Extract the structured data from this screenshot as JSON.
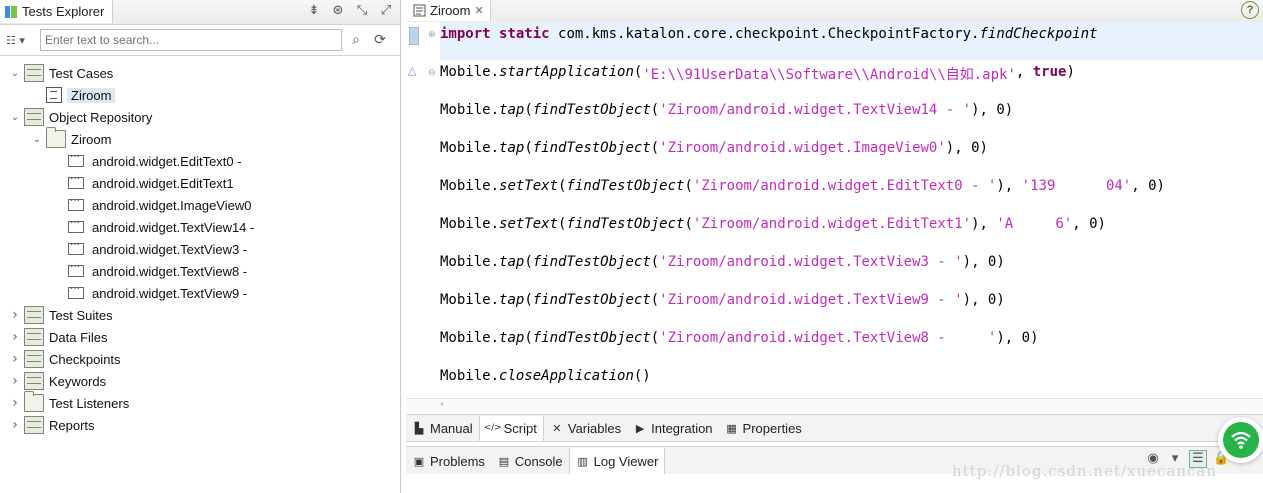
{
  "explorer": {
    "title": "Tests Explorer",
    "search_placeholder": "Enter text to search...",
    "tree": [
      {
        "label": "Test Cases",
        "level": 0,
        "state": "expanded",
        "icon": "test-cases-icon"
      },
      {
        "label": "Ziroom",
        "level": 1,
        "state": "leaf",
        "icon": "test-case-icon",
        "selected": true
      },
      {
        "label": "Object Repository",
        "level": 0,
        "state": "expanded",
        "icon": "object-repository-icon"
      },
      {
        "label": "Ziroom",
        "level": 1,
        "state": "expanded",
        "icon": "folder-icon"
      },
      {
        "label": "android.widget.EditText0 -",
        "level": 2,
        "state": "leaf",
        "icon": "test-object-icon"
      },
      {
        "label": "android.widget.EditText1",
        "level": 2,
        "state": "leaf",
        "icon": "test-object-icon"
      },
      {
        "label": "android.widget.ImageView0",
        "level": 2,
        "state": "leaf",
        "icon": "test-object-icon"
      },
      {
        "label": "android.widget.TextView14 -",
        "level": 2,
        "state": "leaf",
        "icon": "test-object-icon"
      },
      {
        "label": "android.widget.TextView3 -",
        "level": 2,
        "state": "leaf",
        "icon": "test-object-icon"
      },
      {
        "label": "android.widget.TextView8 -",
        "level": 2,
        "state": "leaf",
        "icon": "test-object-icon"
      },
      {
        "label": "android.widget.TextView9 -",
        "level": 2,
        "state": "leaf",
        "icon": "test-object-icon"
      },
      {
        "label": "Test Suites",
        "level": 0,
        "state": "collapsed",
        "icon": "test-suites-icon"
      },
      {
        "label": "Data Files",
        "level": 0,
        "state": "collapsed",
        "icon": "data-files-icon"
      },
      {
        "label": "Checkpoints",
        "level": 0,
        "state": "collapsed",
        "icon": "checkpoints-icon"
      },
      {
        "label": "Keywords",
        "level": 0,
        "state": "collapsed",
        "icon": "keywords-icon"
      },
      {
        "label": "Test Listeners",
        "level": 0,
        "state": "collapsed",
        "icon": "test-listeners-icon"
      },
      {
        "label": "Reports",
        "level": 0,
        "state": "collapsed",
        "icon": "reports-icon"
      }
    ]
  },
  "editor": {
    "tab_title": "Ziroom",
    "help_label": "?",
    "lines": [
      {
        "tokens": [
          [
            "kw",
            "import"
          ],
          [
            "p",
            " "
          ],
          [
            "kw",
            "static"
          ],
          [
            "p",
            " com.kms.katalon.core.checkpoint.CheckpointFactory."
          ],
          [
            "it",
            "findCheckpoint"
          ]
        ]
      },
      {
        "tokens": [
          [
            "p",
            "Mobile."
          ],
          [
            "it",
            "startApplication"
          ],
          [
            "p",
            "("
          ],
          [
            "str",
            "'E:\\\\91UserData\\\\Software\\\\Android\\\\自如.apk'"
          ],
          [
            "p",
            ", "
          ],
          [
            "kw",
            "true"
          ],
          [
            "p",
            ")"
          ]
        ]
      },
      {
        "tokens": [
          [
            "p",
            "Mobile."
          ],
          [
            "it",
            "tap"
          ],
          [
            "p",
            "("
          ],
          [
            "it",
            "findTestObject"
          ],
          [
            "p",
            "("
          ],
          [
            "str",
            "'Ziroom/android.widget.TextView14 - '"
          ],
          [
            "p",
            "), 0)"
          ]
        ]
      },
      {
        "tokens": [
          [
            "p",
            "Mobile."
          ],
          [
            "it",
            "tap"
          ],
          [
            "p",
            "("
          ],
          [
            "it",
            "findTestObject"
          ],
          [
            "p",
            "("
          ],
          [
            "str",
            "'Ziroom/android.widget.ImageView0'"
          ],
          [
            "p",
            "), 0)"
          ]
        ]
      },
      {
        "tokens": [
          [
            "p",
            "Mobile."
          ],
          [
            "it",
            "setText"
          ],
          [
            "p",
            "("
          ],
          [
            "it",
            "findTestObject"
          ],
          [
            "p",
            "("
          ],
          [
            "str",
            "'Ziroom/android.widget.EditText0 - '"
          ],
          [
            "p",
            "), "
          ],
          [
            "str",
            "'139      04'"
          ],
          [
            "p",
            ", 0)"
          ]
        ]
      },
      {
        "tokens": [
          [
            "p",
            "Mobile."
          ],
          [
            "it",
            "setText"
          ],
          [
            "p",
            "("
          ],
          [
            "it",
            "findTestObject"
          ],
          [
            "p",
            "("
          ],
          [
            "str",
            "'Ziroom/android.widget.EditText1'"
          ],
          [
            "p",
            "), "
          ],
          [
            "str",
            "'A     6'"
          ],
          [
            "p",
            ", 0)"
          ]
        ]
      },
      {
        "tokens": [
          [
            "p",
            "Mobile."
          ],
          [
            "it",
            "tap"
          ],
          [
            "p",
            "("
          ],
          [
            "it",
            "findTestObject"
          ],
          [
            "p",
            "("
          ],
          [
            "str",
            "'Ziroom/android.widget.TextView3 - '"
          ],
          [
            "p",
            "), 0)"
          ]
        ]
      },
      {
        "tokens": [
          [
            "p",
            "Mobile."
          ],
          [
            "it",
            "tap"
          ],
          [
            "p",
            "("
          ],
          [
            "it",
            "findTestObject"
          ],
          [
            "p",
            "("
          ],
          [
            "str",
            "'Ziroom/android.widget.TextView9 - '"
          ],
          [
            "p",
            "), 0)"
          ]
        ]
      },
      {
        "tokens": [
          [
            "p",
            "Mobile."
          ],
          [
            "it",
            "tap"
          ],
          [
            "p",
            "("
          ],
          [
            "it",
            "findTestObject"
          ],
          [
            "p",
            "("
          ],
          [
            "str",
            "'Ziroom/android.widget.TextView8 -     '"
          ],
          [
            "p",
            "), 0)"
          ]
        ]
      },
      {
        "tokens": [
          [
            "p",
            "Mobile."
          ],
          [
            "it",
            "closeApplication"
          ],
          [
            "p",
            "()"
          ]
        ]
      }
    ]
  },
  "editor_tabs": [
    {
      "label": "Manual",
      "icon": "manual-icon"
    },
    {
      "label": "Script",
      "icon": "script-icon",
      "active": true
    },
    {
      "label": "Variables",
      "icon": "variables-icon"
    },
    {
      "label": "Integration",
      "icon": "integration-icon"
    },
    {
      "label": "Properties",
      "icon": "properties-icon"
    }
  ],
  "console_tabs": [
    {
      "label": "Problems",
      "icon": "problems-icon"
    },
    {
      "label": "Console",
      "icon": "console-icon"
    },
    {
      "label": "Log Viewer",
      "icon": "log-viewer-icon",
      "active": true
    }
  ],
  "watermark": "http://blog.csdn.net/xuecancan",
  "colors": {
    "keyword": "#7f0055",
    "string": "#c42ac0",
    "accent": "#27b24a"
  }
}
